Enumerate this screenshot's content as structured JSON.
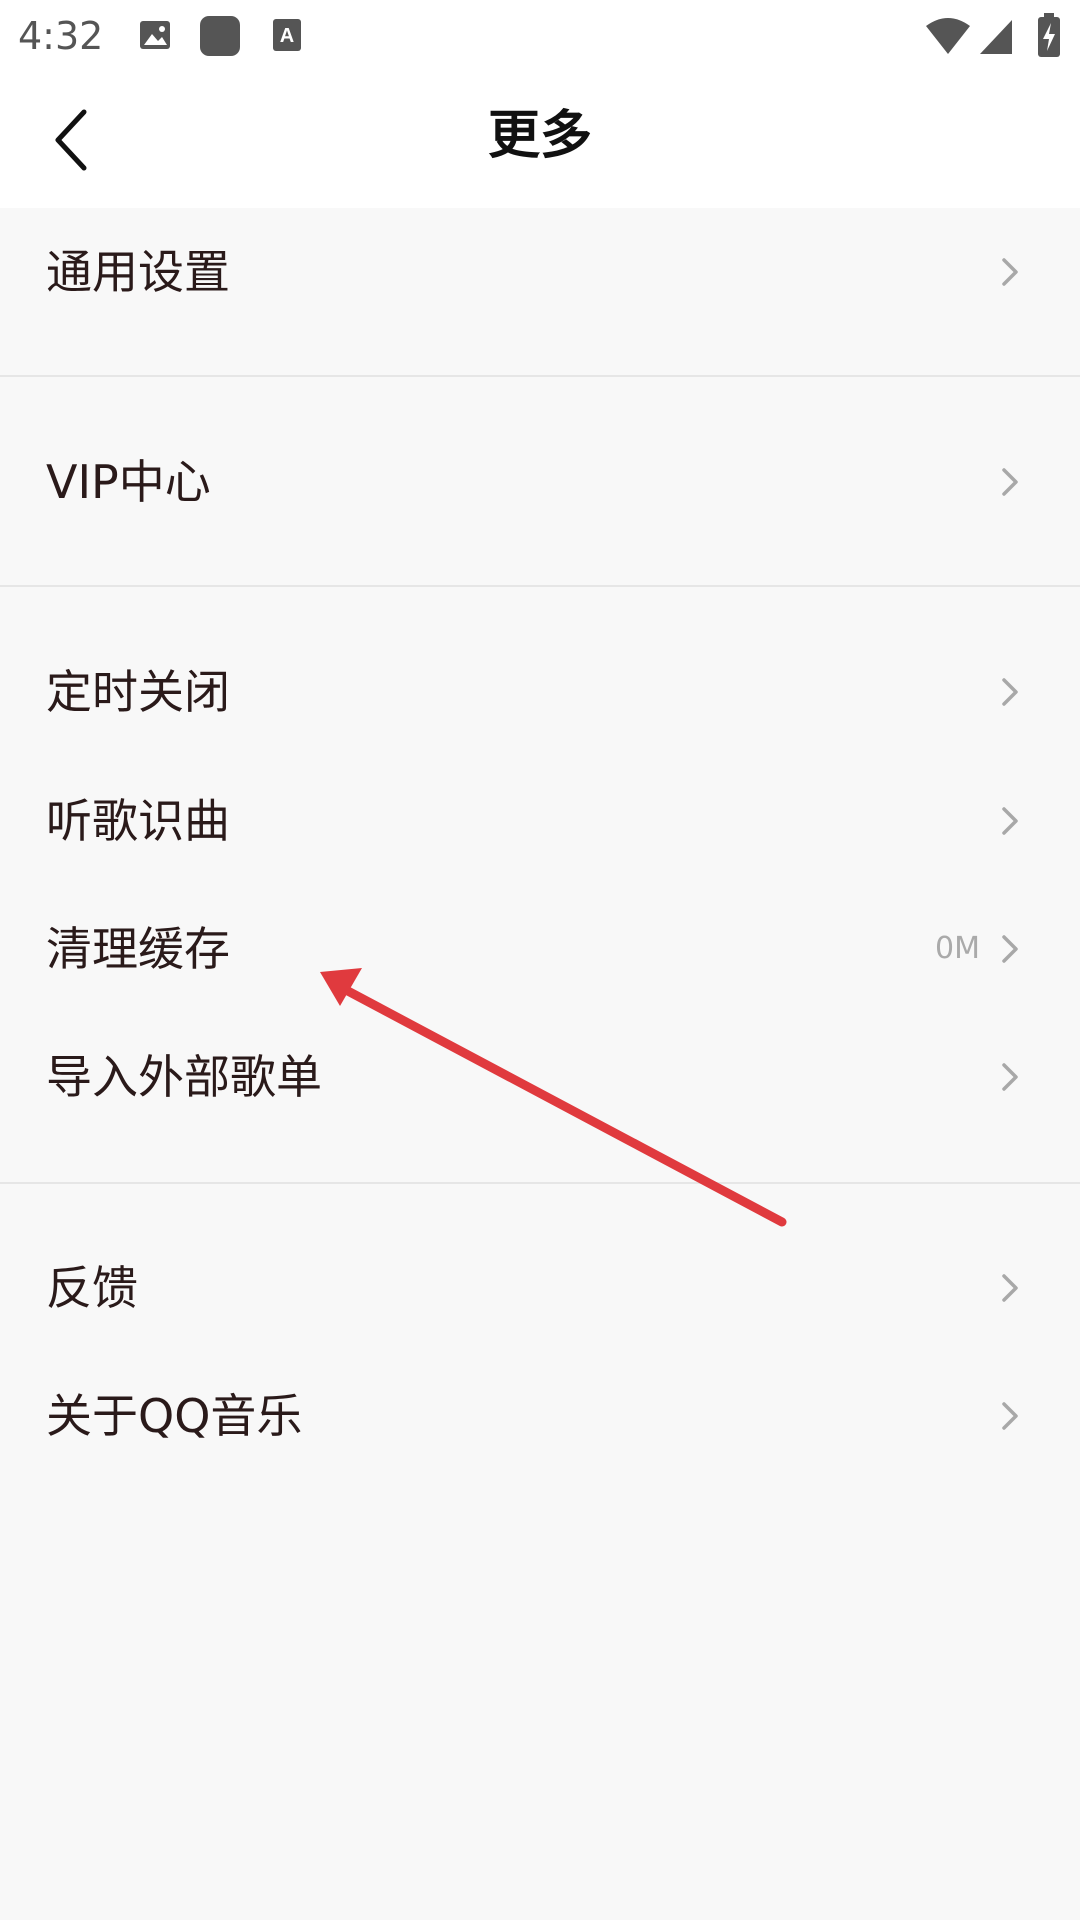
{
  "status_bar": {
    "time": "4:32",
    "icons": [
      "image-icon",
      "app-icon",
      "a-icon",
      "wifi-icon",
      "signal-icon",
      "battery-icon"
    ]
  },
  "header": {
    "title": "更多",
    "back_icon": "chevron-left-icon"
  },
  "menu": {
    "general_settings": "通用设置",
    "vip_center": "VIP中心",
    "sleep_timer": "定时关闭",
    "song_recognition": "听歌识曲",
    "clear_cache": "清理缓存",
    "clear_cache_value": "0M",
    "import_playlist": "导入外部歌单",
    "feedback": "反馈",
    "about": "关于QQ音乐"
  },
  "colors": {
    "annotation_arrow": "#e03a3e",
    "background": "#f8f8f8",
    "header_bg": "#ffffff"
  }
}
